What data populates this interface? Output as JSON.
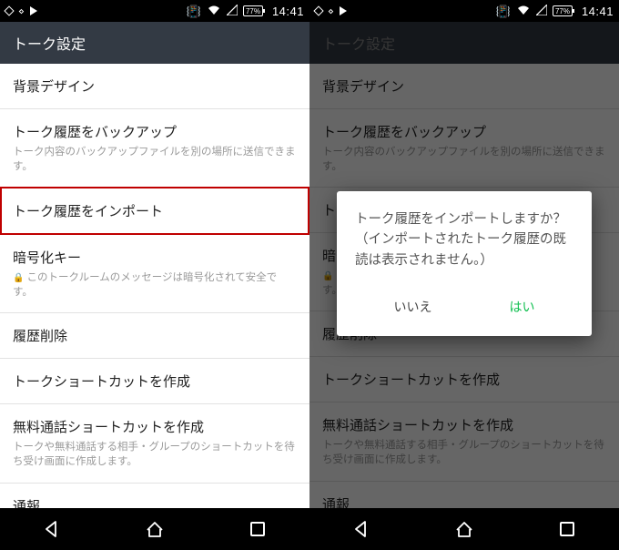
{
  "status": {
    "battery": "77%",
    "time": "14:41"
  },
  "appbar": {
    "title": "トーク設定"
  },
  "items": {
    "bg": {
      "title": "背景デザイン"
    },
    "backup": {
      "title": "トーク履歴をバックアップ",
      "sub": "トーク内容のバックアップファイルを別の場所に送信できます。"
    },
    "import": {
      "title": "トーク履歴をインポート"
    },
    "enc": {
      "title": "暗号化キー",
      "sub": "このトークルームのメッセージは暗号化されて安全です。"
    },
    "delete": {
      "title": "履歴削除"
    },
    "shortcut": {
      "title": "トークショートカットを作成"
    },
    "call": {
      "title": "無料通話ショートカットを作成",
      "sub": "トークや無料通話する相手・グループのショートカットを待ち受け画面に作成します。"
    },
    "report": {
      "title": "通報"
    }
  },
  "right_items": {
    "import_trunc": "トー",
    "enc_trunc_title": "暗",
    "enc_trunc_sub": "🔒",
    "delete_trunc": "履"
  },
  "dialog": {
    "message": "トーク履歴をインポートしますか？（インポートされたトーク履歴の既読は表示されません。）",
    "no": "いいえ",
    "yes": "はい"
  }
}
